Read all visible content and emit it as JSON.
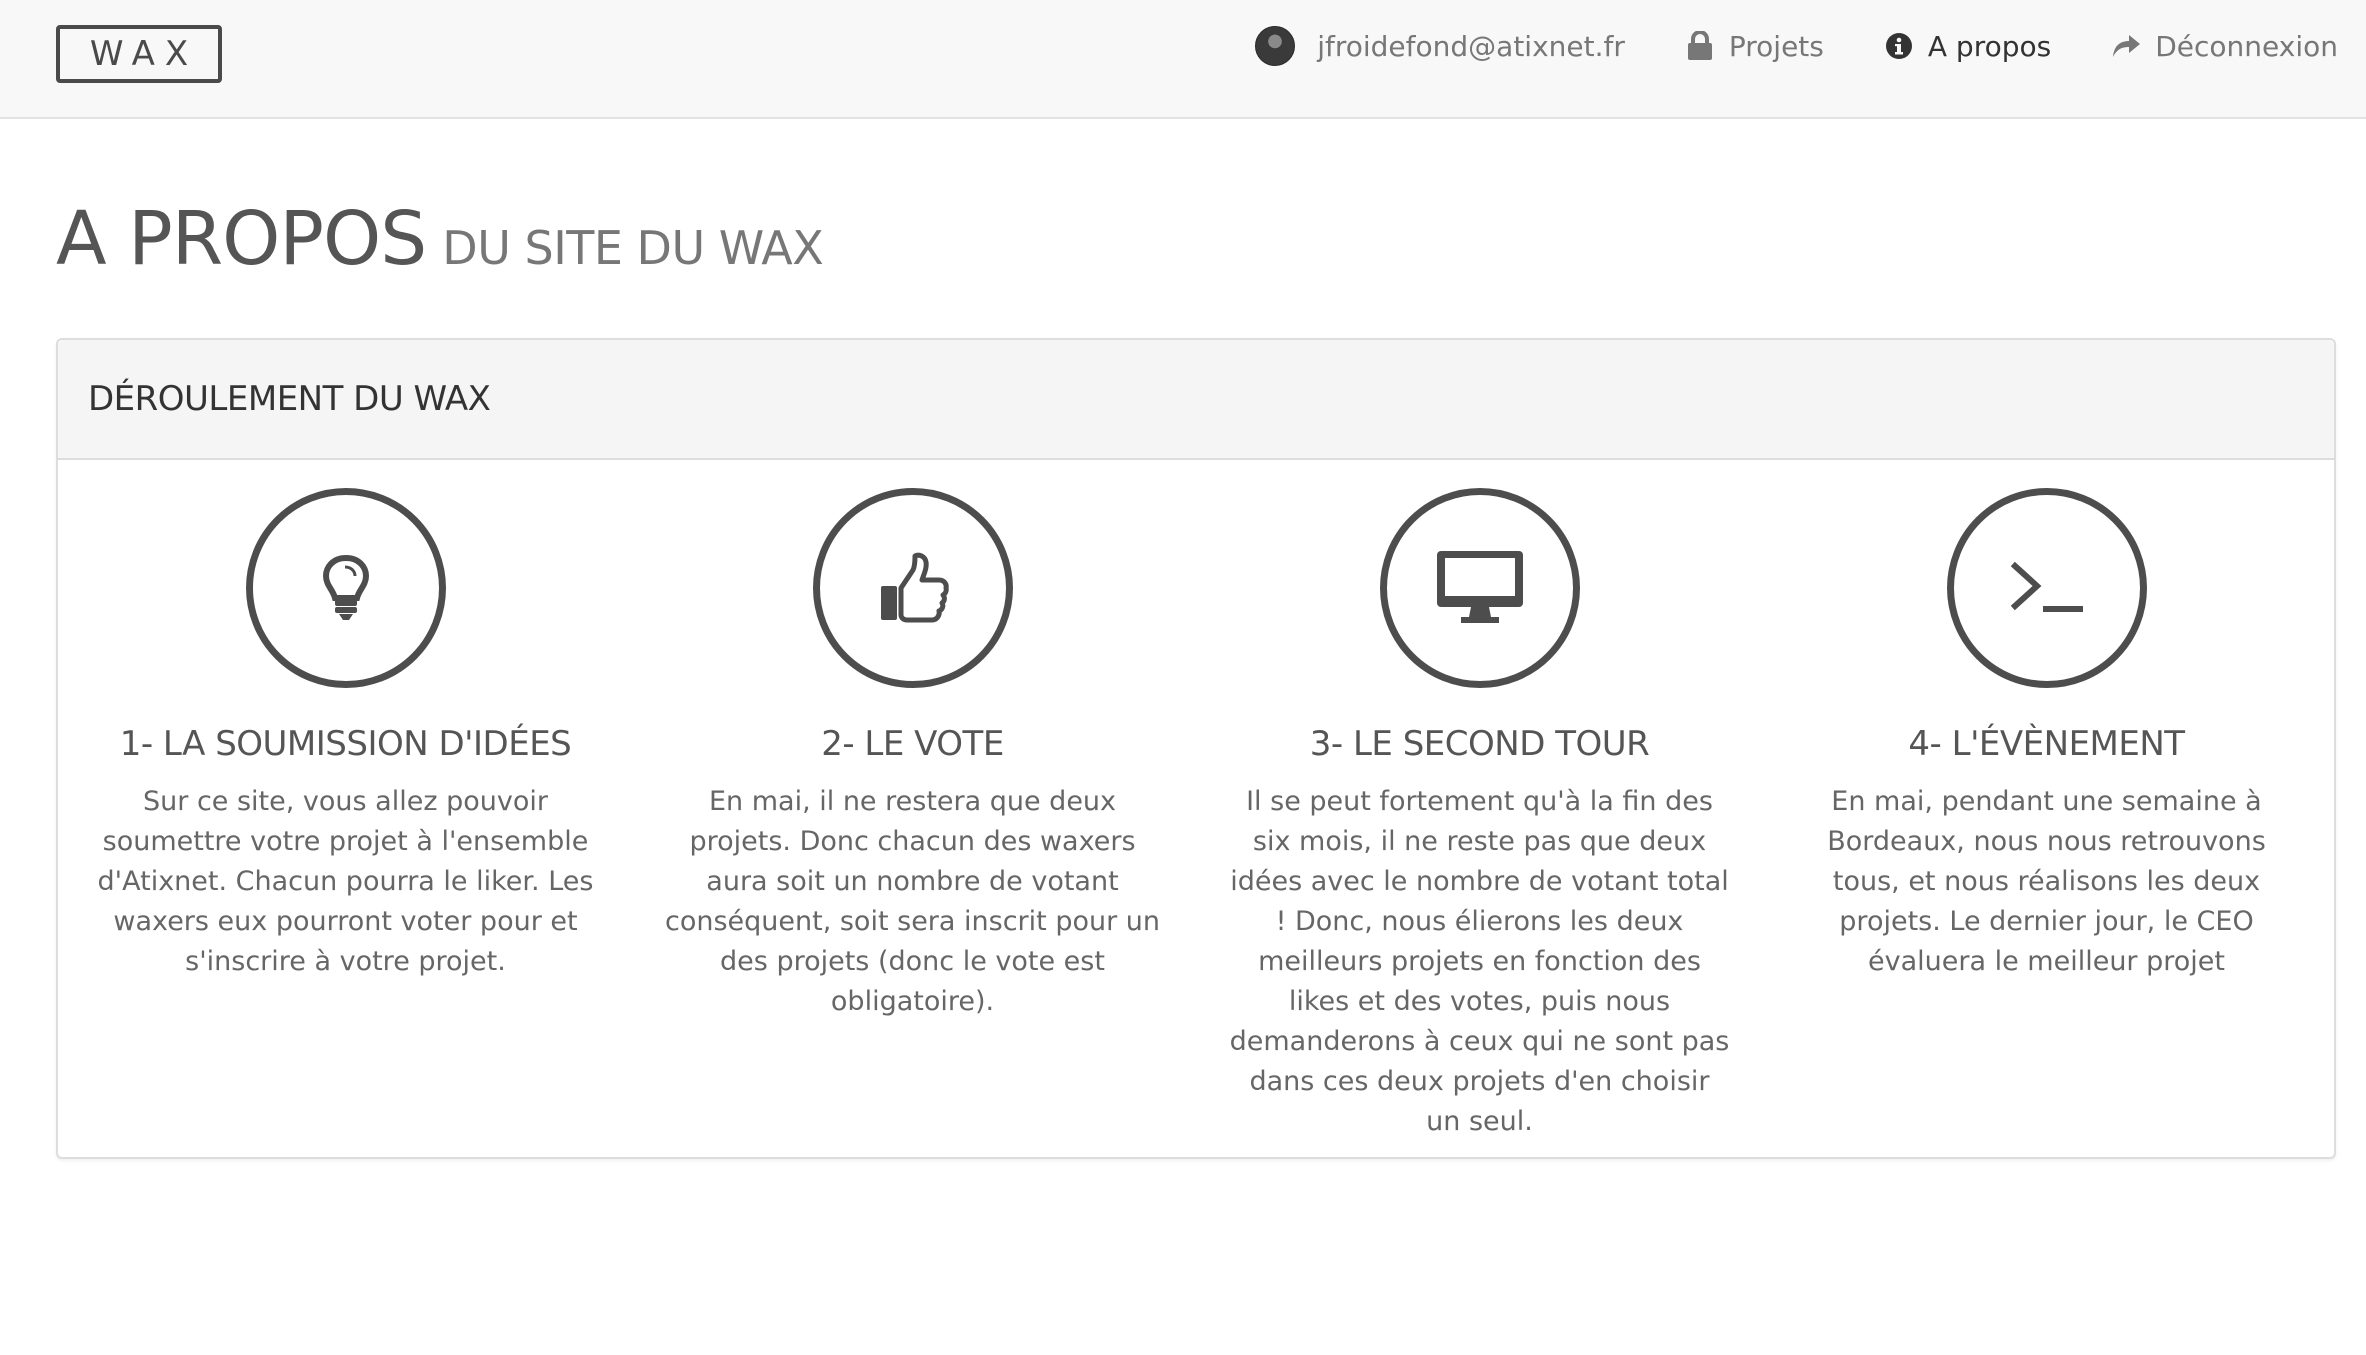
{
  "navbar": {
    "brand": "WAX",
    "user_email": "jfroidefond@atixnet.fr",
    "items": [
      {
        "label": "Projets",
        "icon": "lock-icon"
      },
      {
        "label": "A propos",
        "icon": "info-circle-icon",
        "active": true
      },
      {
        "label": "Déconnexion",
        "icon": "share-arrow-icon"
      }
    ]
  },
  "page": {
    "title": "A PROPOS",
    "subtitle": "DU SITE DU WAX"
  },
  "panel": {
    "title": "DÉROULEMENT DU WAX",
    "steps": [
      {
        "icon": "lightbulb-icon",
        "title": "1- LA SOUMISSION D'IDÉES",
        "text": "Sur ce site, vous allez pouvoir soumettre votre projet à l'ensemble d'Atixnet. Chacun pourra le liker. Les waxers eux pourront voter pour et s'inscrire à votre projet."
      },
      {
        "icon": "thumbs-up-icon",
        "title": "2- LE VOTE",
        "text": "En mai, il ne restera que deux projets. Donc chacun des waxers aura soit un nombre de votant conséquent, soit sera inscrit pour un des projets (donc le vote est obligatoire)."
      },
      {
        "icon": "desktop-icon",
        "title": "3- LE SECOND TOUR",
        "text": "Il se peut fortement qu'à la fin des six mois, il ne reste pas que deux idées avec le nombre de votant total ! Donc, nous élierons les deux meilleurs projets en fonction des likes et des votes, puis nous demanderons à ceux qui ne sont pas dans ces deux projets d'en choisir un seul."
      },
      {
        "icon": "terminal-icon",
        "title": "4- L'ÉVÈNEMENT",
        "text": "En mai, pendant une semaine à Bordeaux, nous nous retrouvons tous, et nous réalisons les deux projets. Le dernier jour, le CEO évaluera le meilleur projet"
      }
    ]
  },
  "colors": {
    "navbar_bg": "#f8f8f8",
    "panel_heading_bg": "#f5f5f5",
    "icon_color": "#4d4d4d",
    "text": "#555555"
  }
}
